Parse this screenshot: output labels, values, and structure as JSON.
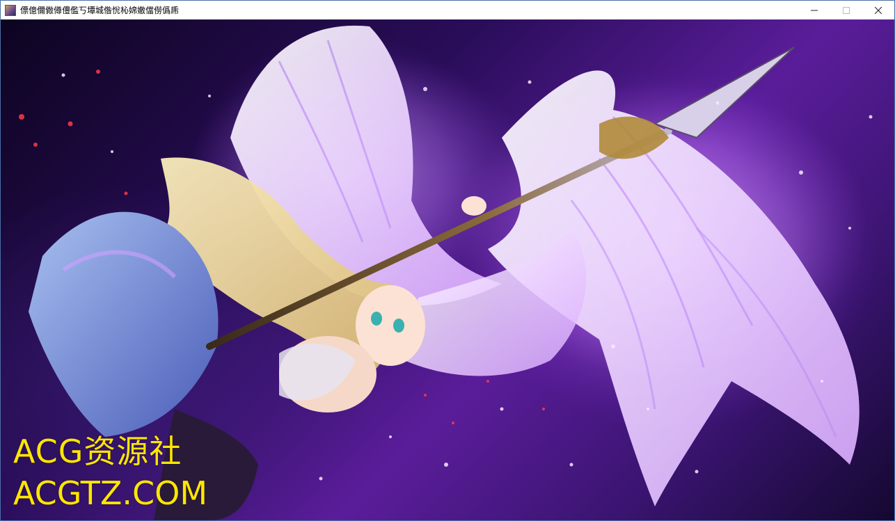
{
  "window": {
    "title": "僄億儞僘僔僼儖丂墰城偺恱杺婂嬓儅僗僞乕",
    "icon": "app-thumbnail-icon",
    "controls": {
      "minimize_icon": "minimize-icon",
      "maximize_icon": "maximize-icon",
      "close_icon": "close-icon"
    }
  },
  "scene": {
    "subject": "winged-warrior-artwork"
  },
  "watermark": {
    "line1": "ACG资源社",
    "line2": "ACGTZ.COM",
    "color": "#ffe600"
  },
  "colors": {
    "background_dark": "#140830",
    "background_purple": "#5a1d9a",
    "wing_glow": "#e0b0ff",
    "hair": "#f0d890",
    "dress": "#6a8ad8"
  }
}
